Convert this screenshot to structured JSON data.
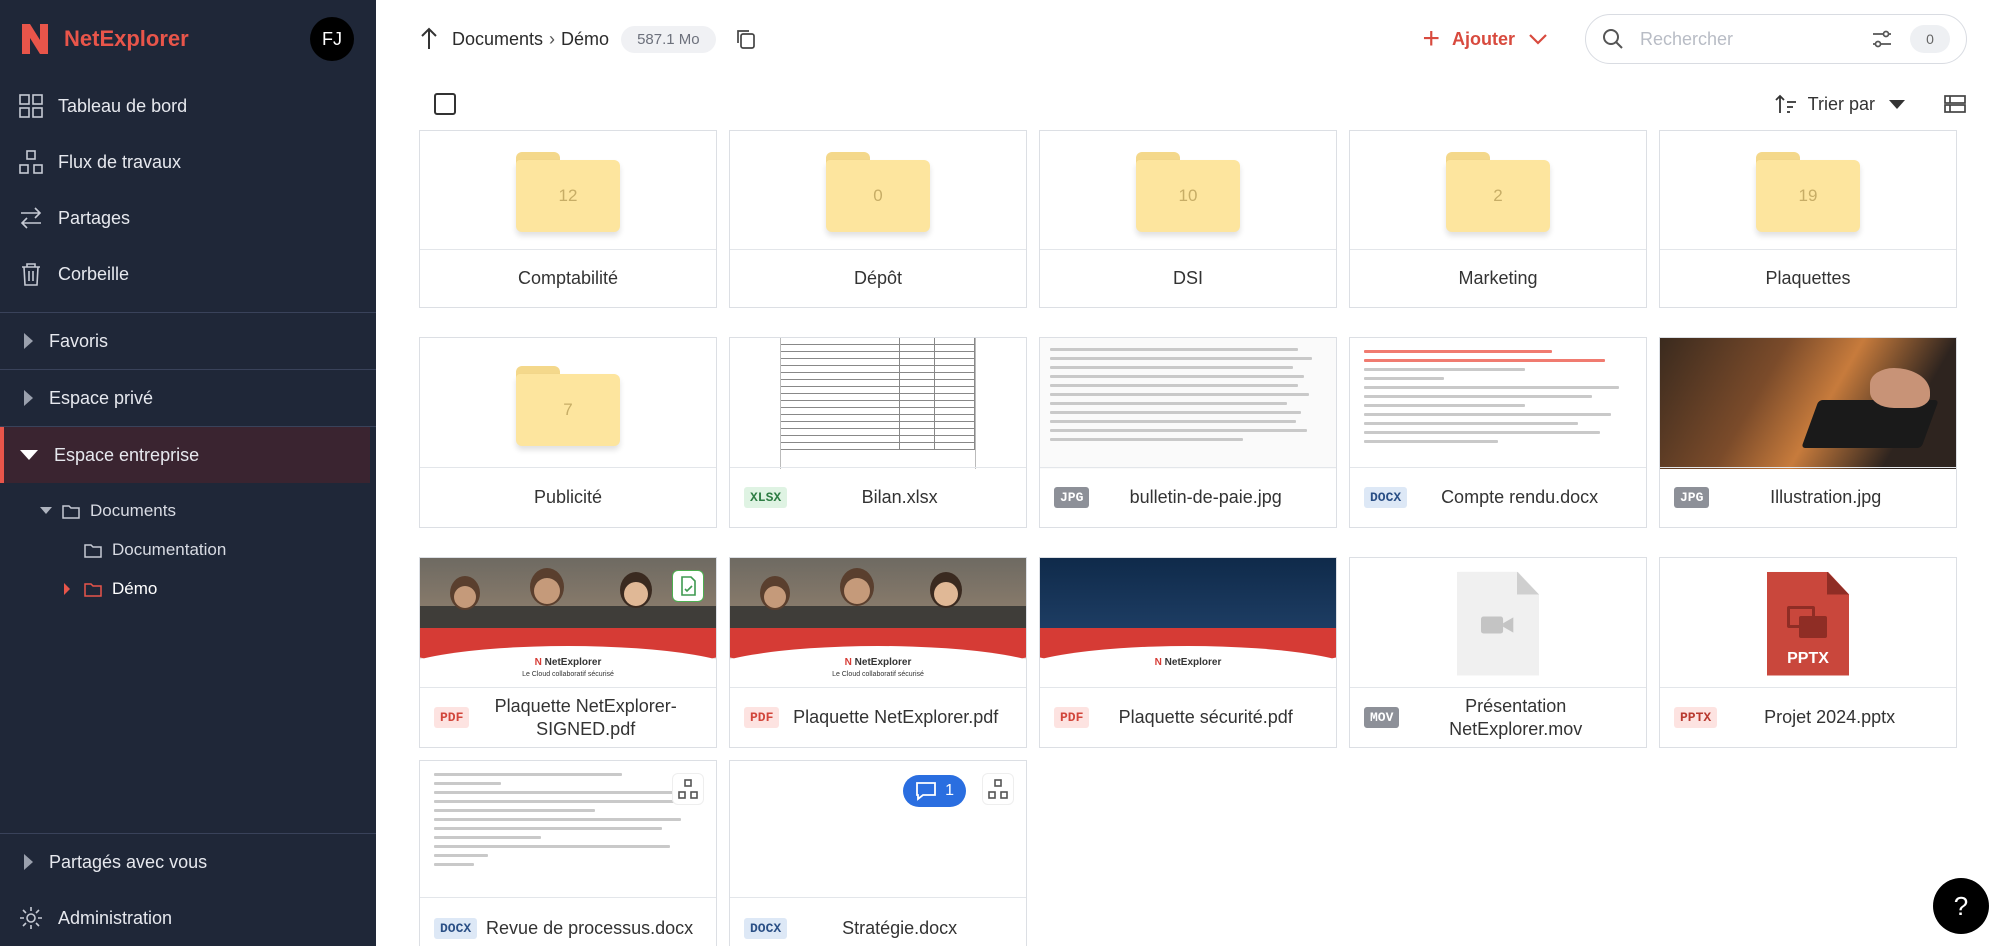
{
  "brand": {
    "name": "NetExplorer",
    "avatar": "FJ",
    "accent": "#e8554a"
  },
  "sidebar": {
    "nav": [
      {
        "label": "Tableau de bord",
        "icon": "dashboard-icon"
      },
      {
        "label": "Flux de travaux",
        "icon": "workflow-icon"
      },
      {
        "label": "Partages",
        "icon": "share-icon"
      },
      {
        "label": "Corbeille",
        "icon": "trash-icon"
      }
    ],
    "sections": {
      "favoris": "Favoris",
      "prive": "Espace privé",
      "entreprise": "Espace entreprise"
    },
    "tree": {
      "documents": "Documents",
      "documentation": "Documentation",
      "demo": "Démo"
    },
    "shared_with_you": "Partagés avec vous",
    "administration": "Administration"
  },
  "topbar": {
    "breadcrumb": [
      "Documents",
      "Démo"
    ],
    "size": "587.1 Mo",
    "add_label": "Ajouter",
    "search_placeholder": "Rechercher",
    "filter_count": "0"
  },
  "toolbar": {
    "sort_label": "Trier par"
  },
  "folders": [
    {
      "name": "Comptabilité",
      "count": "12"
    },
    {
      "name": "Dépôt",
      "count": "0"
    },
    {
      "name": "DSI",
      "count": "10"
    },
    {
      "name": "Marketing",
      "count": "2"
    },
    {
      "name": "Plaquettes",
      "count": "19"
    },
    {
      "name": "Publicité",
      "count": "7"
    }
  ],
  "files": [
    {
      "name": "Bilan.xlsx",
      "type": "XLSX"
    },
    {
      "name": "bulletin-de-paie.jpg",
      "type": "JPG"
    },
    {
      "name": "Compte rendu.docx",
      "type": "DOCX"
    },
    {
      "name": "Illustration.jpg",
      "type": "JPG"
    },
    {
      "name": "Plaquette NetExplorer-SIGNED.pdf",
      "type": "PDF"
    },
    {
      "name": "Plaquette NetExplorer.pdf",
      "type": "PDF"
    },
    {
      "name": "Plaquette sécurité.pdf",
      "type": "PDF"
    },
    {
      "name": "Présentation NetExplorer.mov",
      "type": "MOV"
    },
    {
      "name": "Projet 2024.pptx",
      "type": "PPTX"
    },
    {
      "name": "Revue de processus.docx",
      "type": "DOCX"
    },
    {
      "name": "Stratégie.docx",
      "type": "DOCX"
    }
  ],
  "thumb_text": {
    "brochure_logo": "NetExplorer",
    "brochure_tagline": "Le Cloud collaboratif sécurisé",
    "pptx_icon_label": "PPTX"
  },
  "comment_count": "1",
  "help": "?"
}
